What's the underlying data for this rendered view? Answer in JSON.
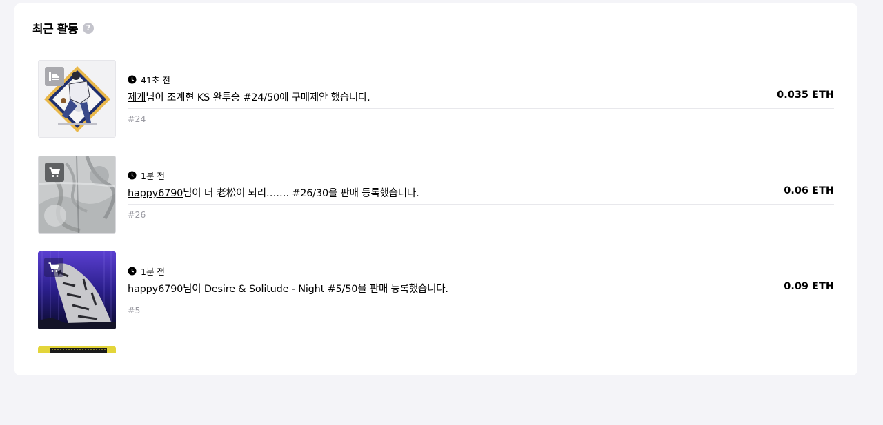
{
  "section": {
    "title": "최근 활동",
    "help_label": "?"
  },
  "activities": [
    {
      "time": "41초 전",
      "user": "제개",
      "action_text": "님이 조계현 KS 완투승 #24/50에 구매제안 했습니다.",
      "price": "0.035 ETH",
      "token_no": "#24",
      "badge_icon": "offer-icon"
    },
    {
      "time": "1분 전",
      "user": "happy6790",
      "action_text": "님이 더 老松이 되리……. #26/30을 판매 등록했습니다.",
      "price": "0.06 ETH",
      "token_no": "#26",
      "badge_icon": "cart-icon"
    },
    {
      "time": "1분 전",
      "user": "happy6790",
      "action_text": "님이 Desire & Solitude - Night #5/50을 판매 등록했습니다.",
      "price": "0.09 ETH",
      "token_no": "#5",
      "badge_icon": "cart-icon"
    }
  ],
  "colors": {
    "page_bg": "#f4f4f8",
    "card_bg": "#ffffff",
    "muted_text": "#9a9aa2",
    "divider": "#e8e8ec"
  }
}
